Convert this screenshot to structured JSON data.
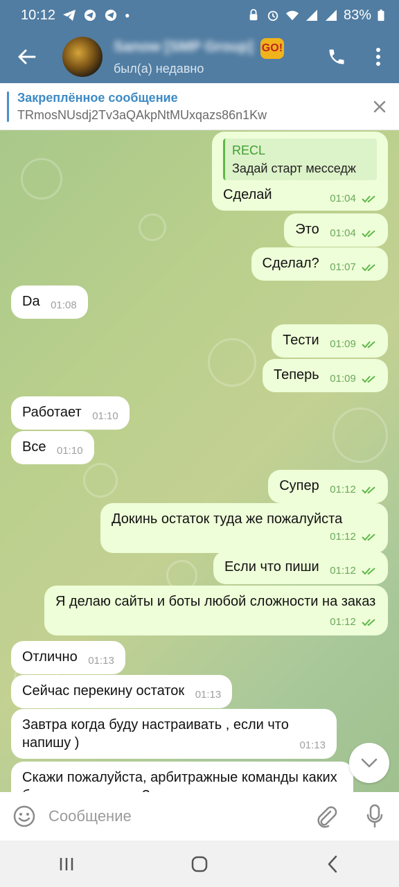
{
  "status_bar": {
    "time": "10:12",
    "battery": "83%"
  },
  "header": {
    "name": "Sanow [SMP Group]",
    "badge": "GO!",
    "status": "был(а) недавно"
  },
  "pinned": {
    "title": "Закреплённое сообщение",
    "text": "TRmosNUsdj2Tv3aQAkpNtMUxqazs86n1Kw"
  },
  "messages": [
    {
      "dir": "out",
      "reply_name": "RECL",
      "reply_text": "Задай старт месседж",
      "text": "Сделай",
      "time": "01:04"
    },
    {
      "dir": "out",
      "text": "Это",
      "time": "01:04"
    },
    {
      "dir": "out",
      "text": "Сделал?",
      "time": "01:07"
    },
    {
      "dir": "in",
      "text": "Da",
      "time": "01:08"
    },
    {
      "dir": "out",
      "text": "Тести",
      "time": "01:09"
    },
    {
      "dir": "out",
      "text": "Теперь",
      "time": "01:09"
    },
    {
      "dir": "in",
      "text": "Работает",
      "time": "01:10"
    },
    {
      "dir": "in",
      "text": "Все",
      "time": "01:10"
    },
    {
      "dir": "out",
      "text": "Супер",
      "time": "01:12"
    },
    {
      "dir": "out",
      "text": "Докинь остаток туда же пожалуйста",
      "time": "01:12"
    },
    {
      "dir": "out",
      "text": "Если что пиши",
      "time": "01:12"
    },
    {
      "dir": "out",
      "text": "Я делаю сайты и боты любой сложности на заказ",
      "time": "01:12"
    },
    {
      "dir": "in",
      "text": "Отлично",
      "time": "01:13"
    },
    {
      "dir": "in",
      "text": "Сейчас перекину остаток",
      "time": "01:13"
    },
    {
      "dir": "in",
      "text": "Завтра когда буду настраивать , если что напишу )",
      "time": "01:13"
    },
    {
      "dir": "in",
      "text": "Скажи пожалуйста, арбитражные команды каких ботов заказывают ?",
      "time": ""
    }
  ],
  "composer": {
    "placeholder": "Сообщение"
  },
  "colors": {
    "header": "#517da2",
    "outgoing": "#eefed8",
    "incoming": "#ffffff",
    "accent": "#3d8ac4"
  },
  "icons": [
    "back-arrow-icon",
    "phone-icon",
    "more-vertical-icon",
    "close-icon",
    "emoji-icon",
    "attach-icon",
    "microphone-icon",
    "chevron-down-icon"
  ]
}
